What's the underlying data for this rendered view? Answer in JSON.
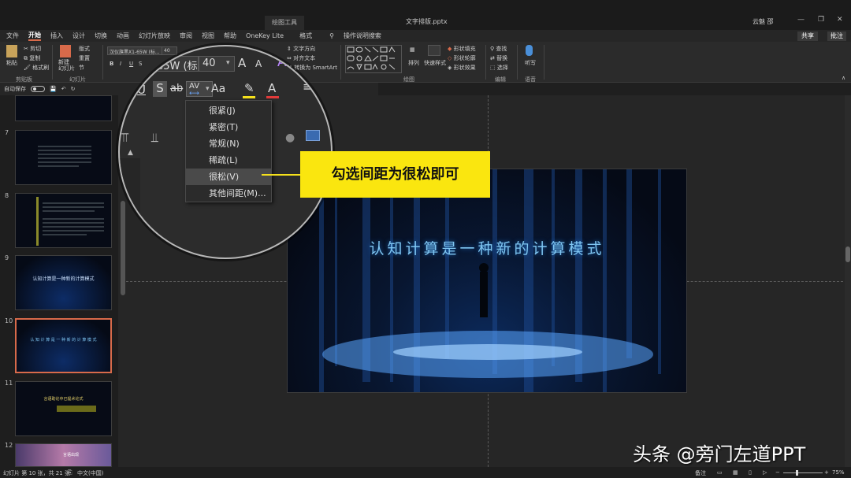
{
  "window": {
    "context_tab": "绘图工具",
    "doc_title": "文字排版.pptx",
    "user": "云魅 邵",
    "min_icon": "—",
    "restore_icon": "❐",
    "close_icon": "✕"
  },
  "menu": {
    "items": [
      "文件",
      "开始",
      "插入",
      "设计",
      "切换",
      "动画",
      "幻灯片放映",
      "审阅",
      "视图",
      "帮助",
      "OneKey Lite",
      "格式"
    ],
    "active": "开始",
    "search": "操作说明搜索",
    "share": "共享",
    "comment": "批注"
  },
  "ribbon": {
    "clipboard": {
      "paste": "粘贴",
      "cut": "剪切",
      "copy": "复制",
      "format_painter": "格式刷",
      "label": "剪贴板"
    },
    "slides": {
      "new_slide": "新建\n幻灯片",
      "layout": "版式",
      "reset": "重置",
      "section": "节",
      "label": "幻灯片"
    },
    "font": {
      "name": "汉仪旗黑X1-65W (标...",
      "size": "40",
      "bold": "B",
      "italic": "I",
      "underline": "U",
      "strike": "S"
    },
    "paragraph": {
      "text_direction": "文字方向",
      "align_text": "对齐文本",
      "smartart": "转换为 SmartArt"
    },
    "drawing": {
      "arrange": "排列",
      "quick_styles": "快速样式",
      "fill": "形状填充",
      "outline": "形状轮廓",
      "effects": "形状效果",
      "label": "绘图"
    },
    "editing": {
      "find": "查找",
      "replace": "替换",
      "select": "选择",
      "label": "编辑"
    },
    "voice": {
      "dictate": "听写",
      "label": "语音"
    }
  },
  "qat": {
    "autosave": "自动保存",
    "autosave_state": "关"
  },
  "thumbnails": [
    {
      "num": "7"
    },
    {
      "num": "8"
    },
    {
      "num": "9",
      "title": "认知计算是一种新的计算模式"
    },
    {
      "num": "10",
      "title": "认 知 计 算 是 一 种 新 的 计 算 模 式",
      "selected": true
    },
    {
      "num": "11",
      "title": "言语助论中已提术论式"
    },
    {
      "num": "12",
      "title": "言语出现"
    }
  ],
  "slide": {
    "title": "认知计算是一种新的计算模式"
  },
  "magnifier": {
    "font_name_partial": "65W (标",
    "font_size": "40",
    "grow": "A",
    "shrink": "A",
    "spacing_btn": "AV",
    "case_btn": "Aa",
    "strike_big": "ab",
    "shadow_big": "S",
    "underline_big": "U"
  },
  "spacing_menu": {
    "items": [
      "很紧(J)",
      "紧密(T)",
      "常规(N)",
      "稀疏(L)",
      "很松(V)",
      "其他间距(M)..."
    ],
    "highlighted": "很松(V)"
  },
  "callout": {
    "text": "勾选间距为很松即可"
  },
  "status": {
    "slide_info": "幻灯片 第 10 张，共 21 张",
    "language": "中文(中国)",
    "notes": "备注",
    "zoom": "75%",
    "minus": "−",
    "plus": "+"
  },
  "watermark": {
    "text": "头条 @旁门左道PPT"
  },
  "colors": {
    "accent": "#d86a4a",
    "callout": "#fae60f",
    "slide_title": "#7fc6f2"
  }
}
